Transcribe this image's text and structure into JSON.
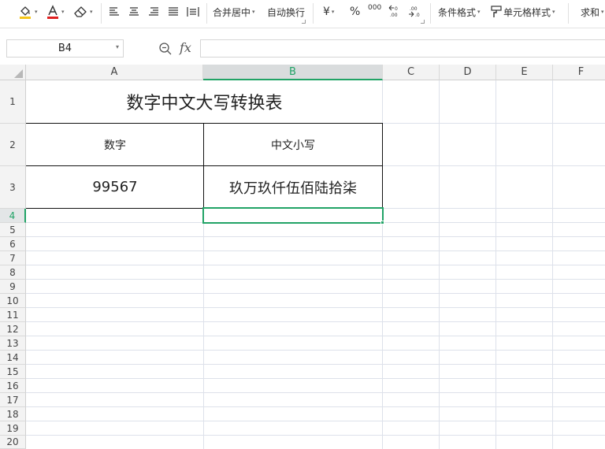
{
  "toolbar": {
    "merge_center": "合并居中",
    "wrap_text": "自动换行",
    "currency_symbol": "¥",
    "percent_symbol": "%",
    "thousands_symbol": "000",
    "cond_format": "条件格式",
    "cell_style": "单元格样式",
    "sum": "求和",
    "icons": [
      "fill-color",
      "font-color",
      "eraser",
      "align-left",
      "align-center",
      "align-right",
      "justify",
      "distributed",
      "increase-decimal",
      "decrease-decimal",
      "cell-style-brush"
    ],
    "colors": {
      "font_color_bar": "#e02020",
      "fill_color_bar": "#f5c518"
    }
  },
  "formula_bar": {
    "name_box": "B4",
    "fx_label": "fx",
    "formula": ""
  },
  "sheet": {
    "columns": [
      "A",
      "B",
      "C",
      "D",
      "E",
      "F"
    ],
    "selected_column": "B",
    "rows": [
      "1",
      "2",
      "3",
      "4",
      "5",
      "6",
      "7",
      "8",
      "9",
      "10",
      "11",
      "12",
      "13",
      "14",
      "15",
      "16",
      "17",
      "18",
      "19",
      "20"
    ],
    "selected_row": "4",
    "cells": {
      "title": "数字中文大写转换表",
      "A2": "数字",
      "B2": "中文小写",
      "A3": "99567",
      "B3": "玖万玖仟伍佰陆拾柒"
    },
    "accent_color": "#21a366"
  }
}
